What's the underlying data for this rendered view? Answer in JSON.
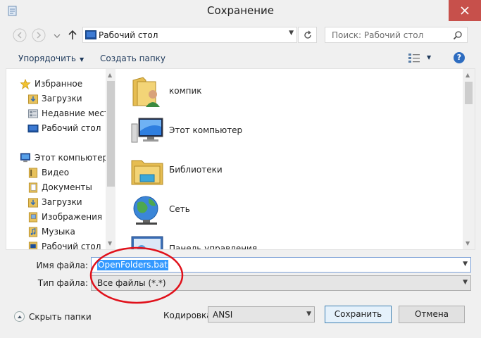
{
  "window": {
    "title": "Сохранение"
  },
  "navbar": {
    "address": "Рабочий стол",
    "search_placeholder": "Поиск: Рабочий стол"
  },
  "toolbar": {
    "organize_label": "Упорядочить",
    "new_folder_label": "Создать папку"
  },
  "nav_pane": {
    "items": [
      {
        "label": "Избранное",
        "icon": "star-icon"
      },
      {
        "label": "Загрузки",
        "icon": "downloads-icon"
      },
      {
        "label": "Недавние места",
        "icon": "recent-places-icon"
      },
      {
        "label": "Рабочий стол",
        "icon": "desktop-icon"
      },
      {
        "label": "Этот компьютер",
        "icon": "computer-icon"
      },
      {
        "label": "Видео",
        "icon": "videos-icon"
      },
      {
        "label": "Документы",
        "icon": "documents-icon"
      },
      {
        "label": "Загрузки",
        "icon": "downloads-icon"
      },
      {
        "label": "Изображения",
        "icon": "pictures-icon"
      },
      {
        "label": "Музыка",
        "icon": "music-icon"
      },
      {
        "label": "Рабочий стол",
        "icon": "desktop-icon"
      }
    ]
  },
  "files": [
    {
      "label": "компик",
      "icon": "user-folder-icon"
    },
    {
      "label": "Этот компьютер",
      "icon": "computer-icon"
    },
    {
      "label": "Библиотеки",
      "icon": "libraries-icon"
    },
    {
      "label": "Сеть",
      "icon": "network-icon"
    },
    {
      "label": "Панель управления",
      "icon": "control-panel-icon"
    }
  ],
  "form": {
    "file_name_label": "Имя файла:",
    "file_name_value": "OpenFolders.bat",
    "file_type_label": "Тип файла:",
    "file_type_value": "Все файлы  (*.*)",
    "encoding_label": "Кодировка:",
    "encoding_value": "ANSI"
  },
  "footer": {
    "hide_folders_label": "Скрыть папки",
    "save_label": "Сохранить",
    "cancel_label": "Отмена"
  },
  "colors": {
    "close_button": "#c7504b",
    "selection": "#3399ff",
    "annotation_circle": "#e0101a",
    "link_text": "#1e395b"
  }
}
